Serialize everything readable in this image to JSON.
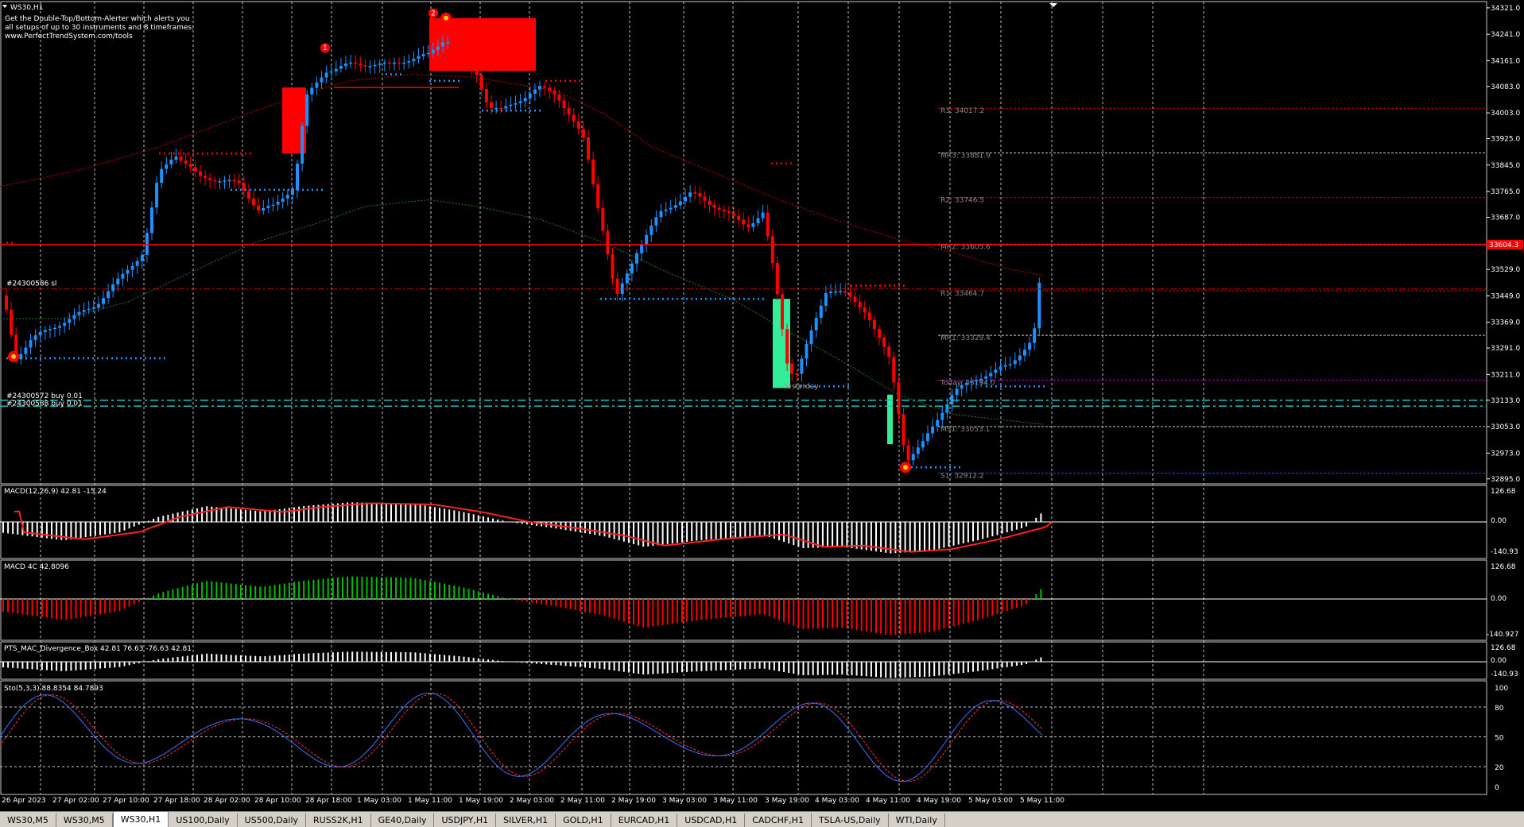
{
  "window": {
    "symbol_title": "WS30,H1",
    "promo_lines": [
      "Get the Double-Top/Bottom-Alerter which alerts you",
      "all setups of up to 30 instruments and 8 timeframes:",
      "www.PerfectTrendSystem.com/tools"
    ],
    "current_price": "33604.3"
  },
  "colors": {
    "background": "#000000",
    "bull_candle": "#1e90ff",
    "bear_candle": "#ff0000",
    "grid": "#c0c0c0",
    "pivot_line": "#c80000",
    "ma_red": "#b40000",
    "ma_green": "#1f7a1f",
    "macd_green": "#00c000",
    "macd_red": "#ff0000",
    "stoch_main": "#3f6fff",
    "stoch_signal": "#ff3030",
    "target_box_green": "#33ee99",
    "tab_bar": "#d4d0c8"
  },
  "main_chart": {
    "y_axis_ticks": [
      "34321.0",
      "34241.0",
      "34161.0",
      "34083.0",
      "34003.0",
      "33925.0",
      "33845.0",
      "33765.0",
      "33687.0",
      "33609.0",
      "33529.0",
      "33449.0",
      "33369.0",
      "33291.0",
      "33211.0",
      "33133.0",
      "33053.0",
      "32973.0",
      "32895.0"
    ],
    "pivot_levels": [
      {
        "label": "R3: 34017.2",
        "value": 34017.2
      },
      {
        "label": "MR3: 33881.9",
        "value": 33881.9
      },
      {
        "label": "R2: 33746.5",
        "value": 33746.5
      },
      {
        "label": "MR2: 33605.6",
        "value": 33605.6
      },
      {
        "label": "R1: 33464.7",
        "value": 33464.7
      },
      {
        "label": "MR1: 33329.4",
        "value": 33329.4
      },
      {
        "label": "Today: 33194.0",
        "value": 33194.0
      },
      {
        "label": "MS1: 33053.1",
        "value": 33053.1
      },
      {
        "label": "S1: 32912.2",
        "value": 32912.2
      }
    ],
    "order_labels": [
      {
        "label": "#24300586 sl",
        "value": 33470
      },
      {
        "label": "#24300572 buy 0.01",
        "value": 33133
      },
      {
        "label": "#24300588 buy 0.01",
        "value": 33115
      }
    ],
    "yesterday_label": "Yesterday",
    "pattern_markers": [
      "1",
      "2"
    ]
  },
  "x_axis_labels": [
    "26 Apr 2023",
    "27 Apr 02:00",
    "27 Apr 10:00",
    "27 Apr 18:00",
    "28 Apr 02:00",
    "28 Apr 10:00",
    "28 Apr 18:00",
    "1 May 03:00",
    "1 May 11:00",
    "1 May 19:00",
    "2 May 03:00",
    "2 May 11:00",
    "2 May 19:00",
    "3 May 03:00",
    "3 May 11:00",
    "3 May 19:00",
    "4 May 03:00",
    "4 May 11:00",
    "4 May 19:00",
    "5 May 03:00",
    "5 May 11:00"
  ],
  "subwindows": {
    "macd": {
      "label": "MACD(12,26,9) 42.81 -15.24",
      "scale_top": "126.68",
      "scale_zero": "0.00",
      "scale_bottom": "-140.93"
    },
    "macd4c": {
      "label": "MACD 4C 42.8096",
      "scale_top": "126.68",
      "scale_zero": "0.00",
      "scale_bottom": "-140.927"
    },
    "divergence": {
      "label": "PTS_MAC_Divergence_Box 42.81 76.63 -76.63 42.81",
      "scale_top": "126.68",
      "scale_zero": "0.00",
      "scale_bottom": "-140.93"
    },
    "stochastic": {
      "label": "Sto(5,3,3) 88.8354 84.7893",
      "scale_ticks": [
        "100",
        "80",
        "50",
        "20",
        "0"
      ]
    }
  },
  "tabs": [
    {
      "label": "WS30,M5",
      "active": false
    },
    {
      "label": "WS30,M5",
      "active": false
    },
    {
      "label": "WS30,H1",
      "active": true
    },
    {
      "label": "US100,Daily",
      "active": false
    },
    {
      "label": "US500,Daily",
      "active": false
    },
    {
      "label": "RUSS2K,H1",
      "active": false
    },
    {
      "label": "GE40,Daily",
      "active": false
    },
    {
      "label": "USDJPY,H1",
      "active": false
    },
    {
      "label": "SILVER,H1",
      "active": false
    },
    {
      "label": "GOLD,H1",
      "active": false
    },
    {
      "label": "EURCAD,H1",
      "active": false
    },
    {
      "label": "USDCAD,H1",
      "active": false
    },
    {
      "label": "CADCHF,H1",
      "active": false
    },
    {
      "label": "TSLA-US,Daily",
      "active": false
    },
    {
      "label": "WTI,Daily",
      "active": false
    }
  ]
}
